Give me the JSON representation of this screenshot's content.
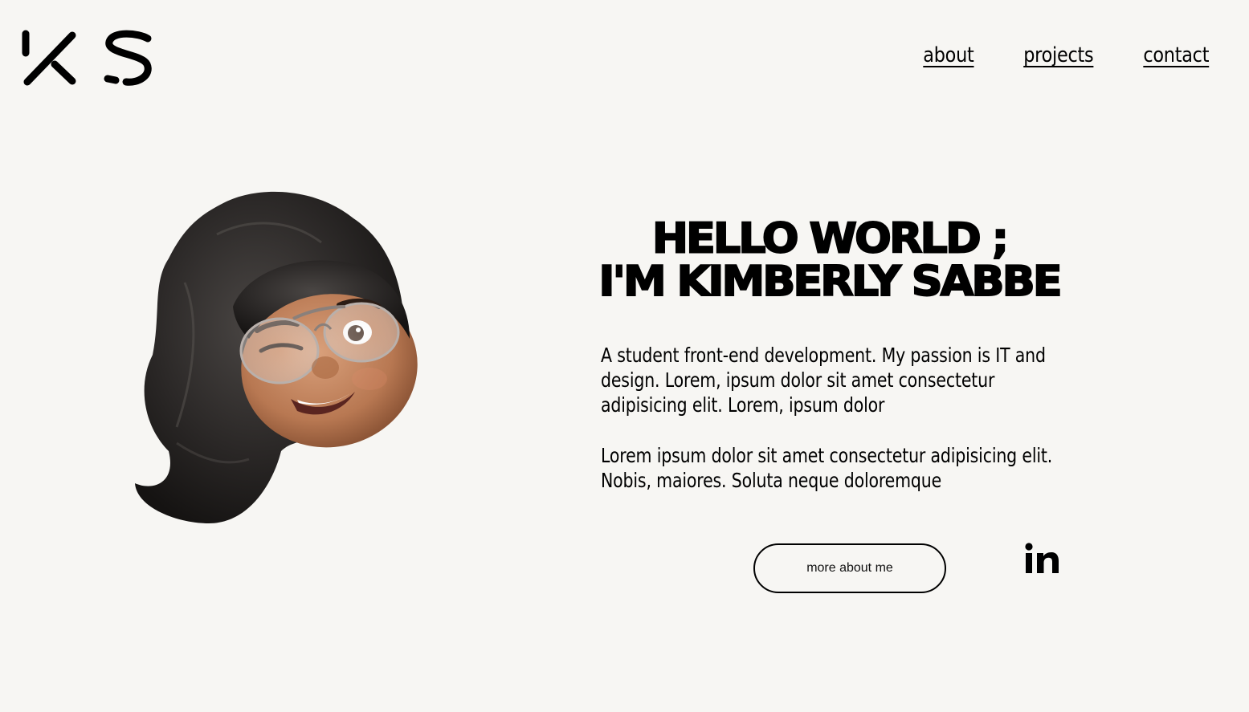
{
  "logo": {
    "alt": "KS"
  },
  "nav": {
    "items": [
      {
        "label": "about"
      },
      {
        "label": "projects"
      },
      {
        "label": "contact"
      }
    ]
  },
  "hero": {
    "title_line1": "HELLO WORLD ;",
    "title_line2": "I'M KIMBERLY SABBE",
    "paragraph1": "A student front-end development. My passion is IT and design. Lorem, ipsum dolor sit amet consectetur adipisicing elit. Lorem, ipsum dolor",
    "paragraph2": "Lorem ipsum dolor sit amet consectetur adipisicing elit. Nobis, maiores. Soluta neque doloremque",
    "more_button": "more about me",
    "social_icon": "linkedin-icon"
  },
  "colors": {
    "background": "#f7f6f3",
    "text": "#000000"
  }
}
